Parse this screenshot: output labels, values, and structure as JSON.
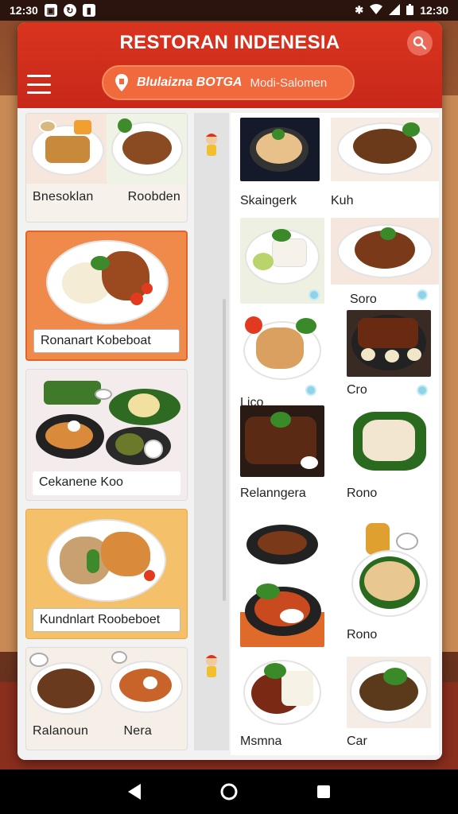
{
  "status_bar": {
    "time_left": "12:30",
    "time_right": "12:30"
  },
  "header": {
    "title": "RESTORAN INDENESIA",
    "location_name": "Blulaizna BOTGA",
    "location_sub": "Modi-Salomen"
  },
  "left_list": [
    {
      "label": "Bnesoklan",
      "label2": "Roobden"
    },
    {
      "label": "Ronanart Kobeboat"
    },
    {
      "label": "Cekanene Koo"
    },
    {
      "label": "Kundnlart Roobeboet"
    },
    {
      "label": "Ralanoun",
      "label2": "Nera"
    }
  ],
  "right_grid": [
    {
      "label": "Skaingerk"
    },
    {
      "label": "Kuh"
    },
    {
      "label": "‹"
    },
    {
      "label": "Soro"
    },
    {
      "label": "Lico"
    },
    {
      "label": "Cro"
    },
    {
      "label": "Relanngera"
    },
    {
      "label": "Rono"
    },
    {
      "label": ""
    },
    {
      "label": "Rono"
    },
    {
      "label": "Msmna"
    },
    {
      "label": "Car"
    }
  ],
  "colors": {
    "header_red": "#d9341f",
    "pill_orange": "#f06a3e",
    "card_orange": "#f08a4b",
    "card_yellow": "#f5c06a"
  },
  "icons": {
    "search": "search-icon",
    "menu": "hamburger-menu-icon",
    "location": "location-pin-icon",
    "back": "back-triangle-icon",
    "home": "home-circle-icon",
    "recents": "recents-square-icon"
  }
}
